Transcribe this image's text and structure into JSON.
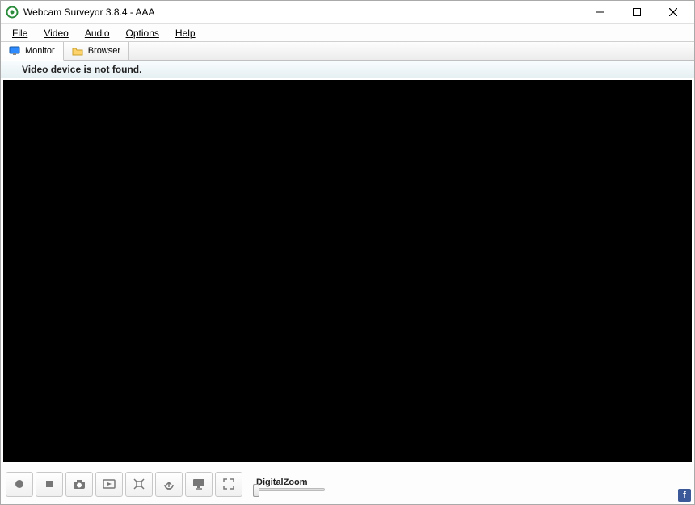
{
  "title": "Webcam Surveyor 3.8.4 - AAA",
  "menu": {
    "file": "File",
    "video": "Video",
    "audio": "Audio",
    "options": "Options",
    "help": "Help"
  },
  "tabs": {
    "monitor": "Monitor",
    "browser": "Browser"
  },
  "status": "Video device is not found.",
  "zoom_label": "DigitalZoom",
  "toolbar_buttons": [
    {
      "name": "record-button"
    },
    {
      "name": "stop-button"
    },
    {
      "name": "snapshot-button"
    },
    {
      "name": "video-clip-button"
    },
    {
      "name": "motion-detection-button"
    },
    {
      "name": "broadcast-button"
    },
    {
      "name": "display-button"
    },
    {
      "name": "fullscreen-button"
    }
  ],
  "fb_label": "f"
}
